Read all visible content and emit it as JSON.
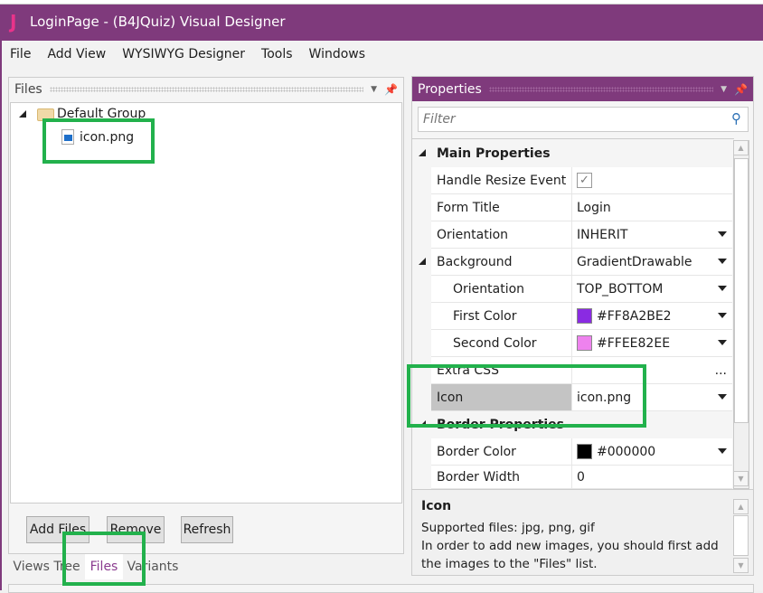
{
  "window": {
    "title": "LoginPage - (B4JQuiz) Visual Designer",
    "logo": "J"
  },
  "menu": [
    "File",
    "Add View",
    "WYSIWYG Designer",
    "Tools",
    "Windows"
  ],
  "files_panel": {
    "title": "Files",
    "tree": {
      "group": "Default Group",
      "items": [
        "icon.png"
      ]
    },
    "buttons": {
      "add": "Add Files",
      "remove": "Remove",
      "refresh": "Refresh"
    }
  },
  "tabs": [
    {
      "label": "Views Tree",
      "selected": false
    },
    {
      "label": "Files",
      "selected": true
    },
    {
      "label": "Variants",
      "selected": false
    }
  ],
  "properties": {
    "title": "Properties",
    "filter_placeholder": "Filter",
    "categories": {
      "main": "Main Properties",
      "border": "Border Properties"
    },
    "rows": [
      {
        "label": "Handle Resize Event",
        "value": "",
        "checked": true
      },
      {
        "label": "Form Title",
        "value": "Login"
      },
      {
        "label": "Orientation",
        "value": "INHERIT"
      },
      {
        "label": "Background",
        "value": "GradientDrawable"
      },
      {
        "label": "Orientation",
        "value": "TOP_BOTTOM"
      },
      {
        "label": "First Color",
        "value": "#FF8A2BE2",
        "swatch": "#8a2be2"
      },
      {
        "label": "Second Color",
        "value": "#FFEE82EE",
        "swatch": "#ee82ee"
      },
      {
        "label": "Extra CSS",
        "value": "..."
      },
      {
        "label": "Icon",
        "value": "icon.png",
        "selected": true
      },
      {
        "label": "Border Color",
        "value": "#000000",
        "swatch": "#000000"
      },
      {
        "label": "Border Width",
        "value": "0"
      }
    ],
    "description": {
      "title": "Icon",
      "line1": "Supported files: jpg, png, gif",
      "line2": "In order to add new images, you should first add the images to the \"Files\" list."
    }
  },
  "colors": {
    "accent": "#7f3a7c",
    "highlight": "#22b14c"
  }
}
